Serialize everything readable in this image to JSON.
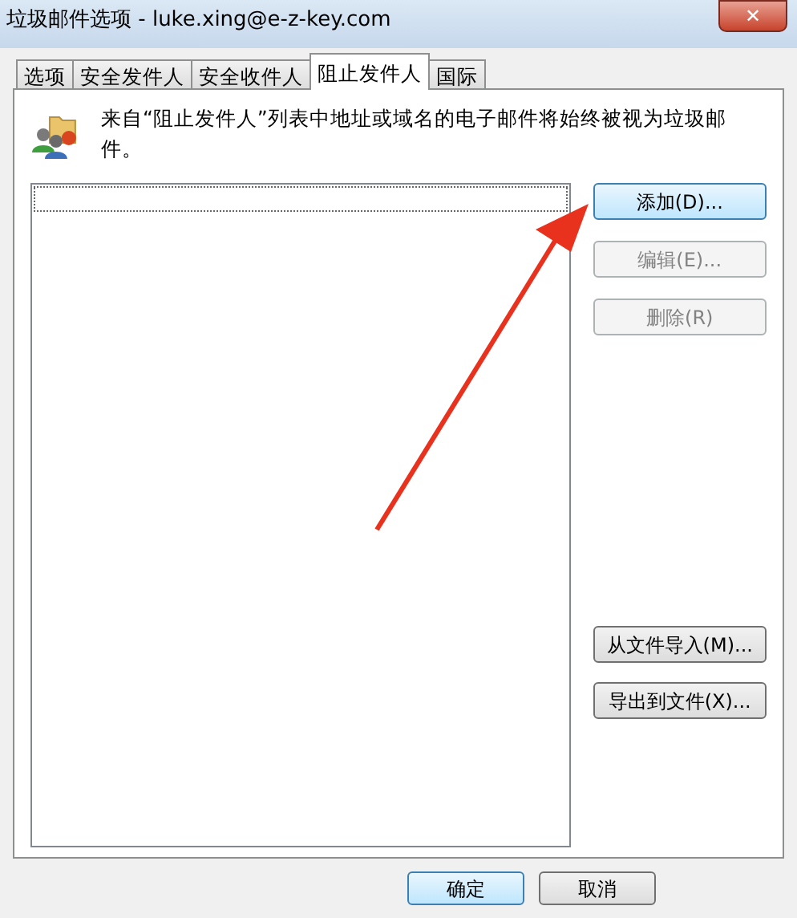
{
  "window": {
    "title": "垃圾邮件选项 - luke.xing@e-z-key.com",
    "close": "✕"
  },
  "tabs": [
    {
      "label": "选项",
      "selected": false
    },
    {
      "label": "安全发件人",
      "selected": false
    },
    {
      "label": "安全收件人",
      "selected": false
    },
    {
      "label": "阻止发件人",
      "selected": true
    },
    {
      "label": "国际",
      "selected": false
    }
  ],
  "description": "来自“阻止发件人”列表中地址或域名的电子邮件将始终被视为垃圾邮件。",
  "side_buttons": [
    {
      "label": "添加(D)...",
      "disabled": false,
      "focused": true
    },
    {
      "label": "编辑(E)...",
      "disabled": true,
      "focused": false
    },
    {
      "label": "删除(R)",
      "disabled": true,
      "focused": false
    }
  ],
  "file_buttons": [
    {
      "label": "从文件导入(M)...",
      "disabled": false
    },
    {
      "label": "导出到文件(X)...",
      "disabled": false
    }
  ],
  "footer_buttons": [
    {
      "label": "确定",
      "default": true
    },
    {
      "label": "取消",
      "default": false
    }
  ]
}
